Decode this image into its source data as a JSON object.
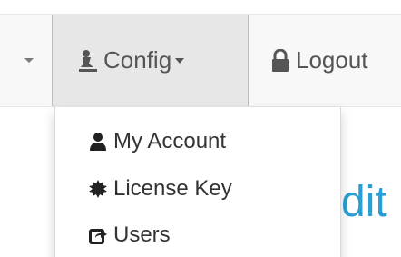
{
  "navbar": {
    "items": [
      {
        "label": ""
      },
      {
        "label": "Config",
        "icon": "chess-pawn-icon"
      },
      {
        "label": "Logout",
        "icon": "lock-icon"
      }
    ]
  },
  "dropdown": {
    "items": [
      {
        "label": "My Account",
        "icon": "user-icon"
      },
      {
        "label": "License Key",
        "icon": "certificate-icon"
      },
      {
        "label": "Users",
        "icon": "share-icon"
      }
    ]
  },
  "background": {
    "heading_fragment": "dit"
  },
  "colors": {
    "navbar_bg": "#f8f8f8",
    "active_bg": "#e7e7e7",
    "text": "#333333",
    "nav_text": "#555555",
    "heading": "#2a9fd6"
  }
}
